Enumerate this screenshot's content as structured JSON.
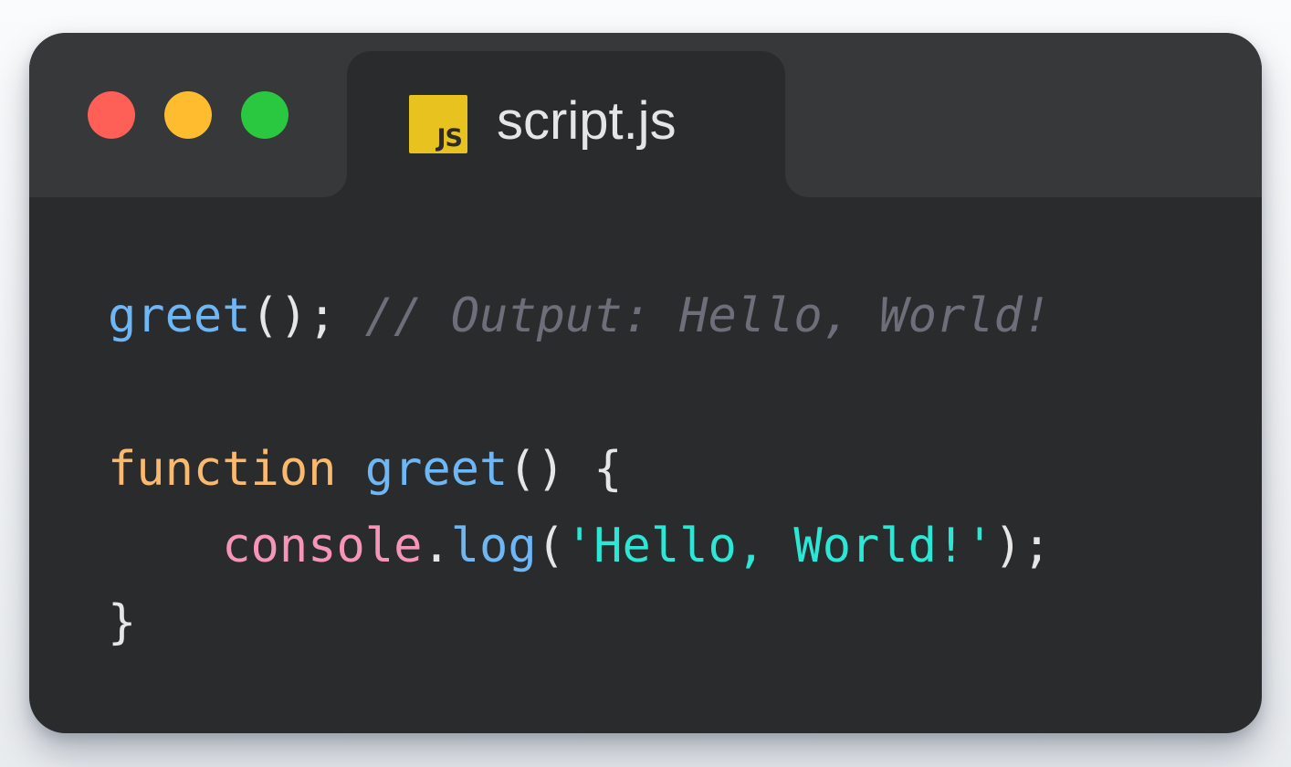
{
  "window": {
    "controls": {
      "close": "close-window-button",
      "minimize": "minimize-window-button",
      "maximize": "maximize-window-button"
    },
    "tab": {
      "icon_text": "JS",
      "title": "script.js"
    }
  },
  "code": {
    "line1": {
      "call_name": "greet",
      "call_punct": "();",
      "comment": "// Output: Hello, World!"
    },
    "line3": {
      "keyword": "function",
      "name": "greet",
      "punct": "() {"
    },
    "line4": {
      "indent": "    ",
      "object": "console",
      "dot": ".",
      "method": "log",
      "open": "(",
      "string": "'Hello, World!'",
      "close": ");"
    },
    "line5": {
      "punct": "}"
    }
  },
  "colors": {
    "background": "#2a2b2d",
    "titlebar": "#373839",
    "function": "#6fb6f5",
    "keyword": "#fbb96e",
    "object": "#f795b7",
    "string": "#2ae7d6",
    "comment": "#6c6e79",
    "close": "#fe5f57",
    "minimize": "#febc2e",
    "maximize": "#29c840",
    "js_badge": "#e8c31f"
  }
}
